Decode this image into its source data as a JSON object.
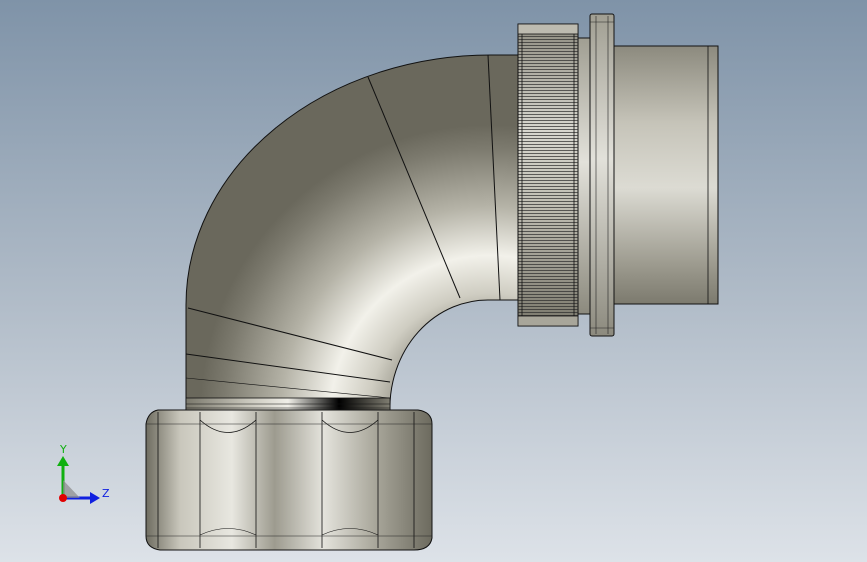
{
  "triad": {
    "y_axis_label": "Y",
    "z_axis_label": "Z",
    "x_axis_color": "#e00000",
    "y_axis_color": "#10b010",
    "z_axis_color": "#1020e0"
  },
  "model": {
    "icon": "elbow-fitting-icon",
    "colors": {
      "metal_light": "#eceae2",
      "metal_mid": "#b8b6aa",
      "metal_dark": "#6e6c60",
      "edge": "#101010"
    }
  }
}
